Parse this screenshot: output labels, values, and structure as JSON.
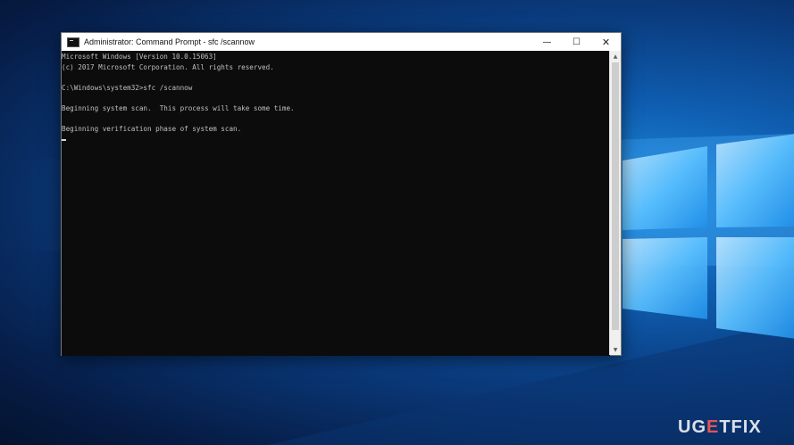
{
  "window": {
    "title": "Administrator: Command Prompt - sfc  /scannow",
    "controls": {
      "minimize": "—",
      "maximize": "☐",
      "close": "✕"
    }
  },
  "console": {
    "lines": [
      "Microsoft Windows [Version 10.0.15063]",
      "(c) 2017 Microsoft Corporation. All rights reserved.",
      "",
      "C:\\Windows\\system32>sfc /scannow",
      "",
      "Beginning system scan.  This process will take some time.",
      "",
      "Beginning verification phase of system scan."
    ]
  },
  "scrollbar": {
    "up_arrow": "▲",
    "down_arrow": "▼"
  },
  "watermark": {
    "prefix": "UG",
    "accent": "E",
    "suffix": "TFIX"
  },
  "colors": {
    "console_bg": "#0c0c0c",
    "console_text": "#c0c0c0",
    "titlebar_bg": "#ffffff",
    "desktop_blue": "#0f5db0"
  }
}
